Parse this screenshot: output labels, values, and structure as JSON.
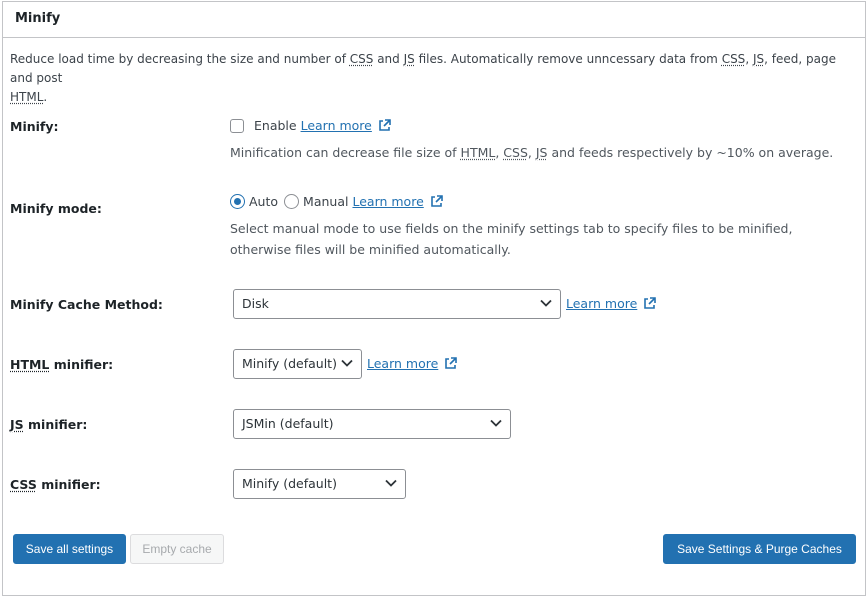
{
  "panel": {
    "title": "Minify"
  },
  "intro": {
    "t1": "Reduce load time by decreasing the size and number of ",
    "abbr1": "CSS",
    "t2": " and ",
    "abbr2": "JS",
    "t3": " files. Automatically remove unncessary data from ",
    "abbr3": "CSS",
    "t4": ", ",
    "abbr4": "JS",
    "t5": ", feed, page and post ",
    "abbr5": "HTML",
    "t6": "."
  },
  "minify": {
    "label": "Minify:",
    "checkbox_label": "Enable",
    "checked": false,
    "learn_more": "Learn more",
    "desc_t1": "Minification can decrease file size of ",
    "desc_abbr1": "HTML",
    "desc_t2": ", ",
    "desc_abbr2": "CSS",
    "desc_t3": ", ",
    "desc_abbr3": "JS",
    "desc_t4": " and feeds respectively by ~10% on average."
  },
  "minify_mode": {
    "label": "Minify mode:",
    "options": [
      "Auto",
      "Manual"
    ],
    "selected": "Auto",
    "learn_more": "Learn more",
    "desc_line1": "Select manual mode to use fields on the minify settings tab to specify files to be minified,",
    "desc_line2": "otherwise files will be minified automatically."
  },
  "cache_method": {
    "label": "Minify Cache Method:",
    "value": "Disk",
    "learn_more": "Learn more"
  },
  "html_minifier": {
    "label_abbr": "HTML",
    "label_rest": " minifier:",
    "value": "Minify (default)",
    "learn_more": "Learn more"
  },
  "js_minifier": {
    "label_abbr": "JS",
    "label_rest": " minifier:",
    "value": "JSMin (default)"
  },
  "css_minifier": {
    "label_abbr": "CSS",
    "label_rest": " minifier:",
    "value": "Minify (default)"
  },
  "buttons": {
    "save_all": "Save all settings",
    "empty_cache": "Empty cache",
    "save_purge": "Save Settings & Purge Caches"
  },
  "colors": {
    "accent": "#2271b1",
    "border": "#c3c4c7",
    "disabled_text": "#a7aaad"
  },
  "icons": {
    "external_link": "external-link-icon",
    "select_chevron": "chevron-down-icon"
  }
}
